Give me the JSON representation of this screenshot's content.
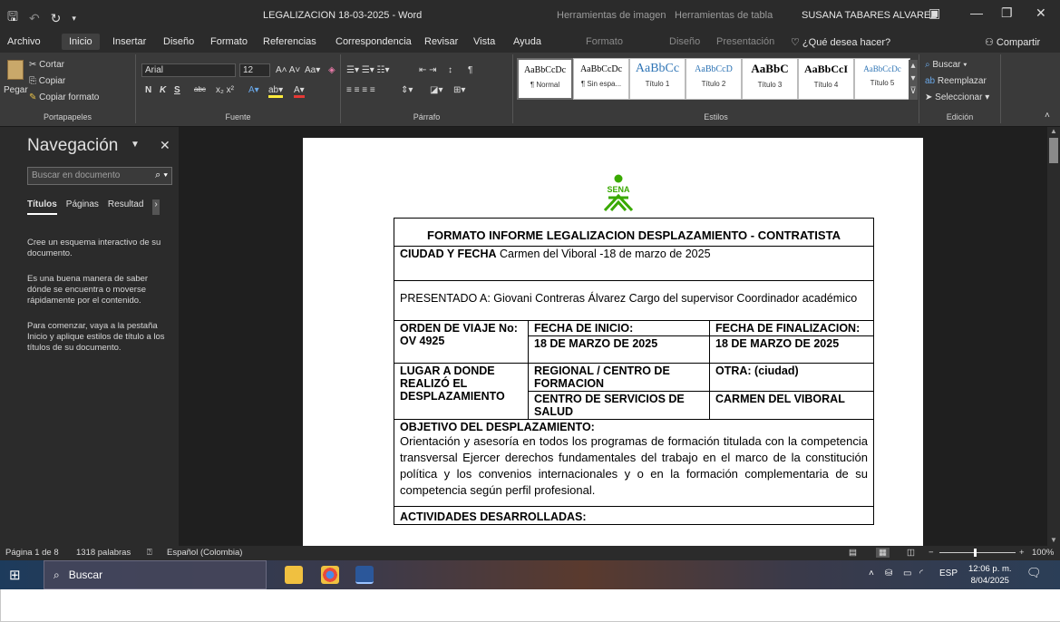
{
  "window": {
    "title": "LEGALIZACION 18-03-2025  -  Word",
    "context_tab_1": "Herramientas de imagen",
    "context_tab_2": "Herramientas de tabla",
    "user": "SUSANA TABARES ALVAREZ"
  },
  "menu": {
    "tabs": [
      "Archivo",
      "Inicio",
      "Insertar",
      "Diseño",
      "Formato",
      "Referencias",
      "Correspondencia",
      "Revisar",
      "Vista",
      "Ayuda"
    ],
    "context_tabs": [
      "Formato",
      "Diseño",
      "Presentación"
    ],
    "tell_me": "¿Qué desea hacer?",
    "share": "Compartir"
  },
  "ribbon": {
    "clipboard": {
      "cut": "Cortar",
      "copy": "Copiar",
      "paste": "Pegar",
      "format_painter": "Copiar formato",
      "label": "Portapapeles"
    },
    "font": {
      "name": "Arial",
      "size": "12",
      "label": "Fuente",
      "bold": "N",
      "italic": "K",
      "underline": "S",
      "strike": "abc"
    },
    "paragraph": {
      "label": "Párrafo"
    },
    "styles": {
      "label": "Estilos",
      "items": [
        {
          "sample": "AaBbCcDc",
          "name": "¶ Normal"
        },
        {
          "sample": "AaBbCcDc",
          "name": "¶ Sin espa..."
        },
        {
          "sample": "AaBbCc",
          "name": "Título 1"
        },
        {
          "sample": "AaBbCcD",
          "name": "Título 2"
        },
        {
          "sample": "AaBbC",
          "name": "Título 3"
        },
        {
          "sample": "AaBbCcI",
          "name": "Título 4"
        },
        {
          "sample": "AaBbCcDc",
          "name": "Título 5"
        }
      ]
    },
    "editing": {
      "find": "Buscar",
      "replace": "Reemplazar",
      "select": "Seleccionar",
      "label": "Edición"
    }
  },
  "nav": {
    "title": "Navegación",
    "search_placeholder": "Buscar en documento",
    "tabs": [
      "Títulos",
      "Páginas",
      "Resultad"
    ],
    "messages": [
      "Cree un esquema interactivo de su documento.",
      "Es una buena manera de saber dónde se encuentra o moverse rápidamente por el contenido.",
      "Para comenzar, vaya a la pestaña Inicio y aplique estilos de título a los títulos de su documento."
    ]
  },
  "document": {
    "logo_text": "SENA",
    "heading": "FORMATO INFORME LEGALIZACION DESPLAZAMIENTO - CONTRATISTA",
    "city_label": "CIUDAD Y FECHA",
    "city_value": "Carmen del Viboral -18 de marzo de 2025",
    "presented": "PRESENTADO A: Giovani Contreras Álvarez Cargo del supervisor Coordinador académico",
    "order_label": "ORDEN DE VIAJE No: OV 4925",
    "start_label": "FECHA DE INICIO:",
    "end_label": "FECHA DE FINALIZACION:",
    "start_date": "18 DE MARZO DE 2025",
    "end_date": "18 DE MARZO DE 2025",
    "place_label": "LUGAR A DONDE REALIZÓ EL DESPLAZAMIENTO",
    "regional_label": "REGIONAL / CENTRO DE FORMACION",
    "other_label": "OTRA: (ciudad)",
    "center_value": "CENTRO DE SERVICIOS DE SALUD",
    "city_other": "CARMEN DEL VIBORAL",
    "objective_label": "OBJETIVO DEL DESPLAZAMIENTO:",
    "objective_text": "Orientación y asesoría en todos los programas de formación titulada con la competencia transversal Ejercer derechos fundamentales del trabajo en el marco de la constitución política y los convenios internacionales y o en la formación complementaria de su competencia según perfil profesional.",
    "activities_label": "ACTIVIDADES  DESARROLLADAS:"
  },
  "status": {
    "page": "Página 1 de 8",
    "words": "1318 palabras",
    "language": "Español (Colombia)",
    "zoom": "100%"
  },
  "taskbar": {
    "search": "Buscar",
    "lang": "ESP",
    "time": "12:06 p. m.",
    "date": "8/04/2025"
  }
}
